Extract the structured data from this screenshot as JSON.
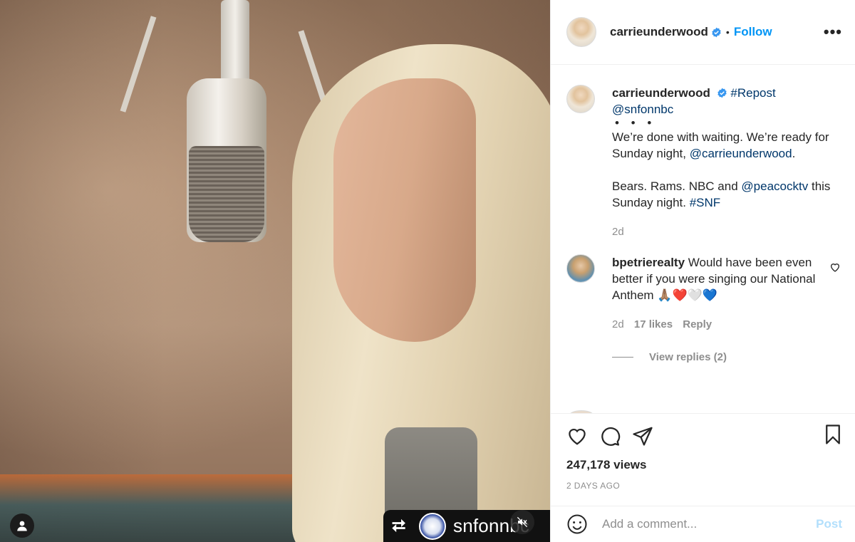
{
  "header": {
    "username": "carrieunderwood",
    "separator": "•",
    "follow_label": "Follow",
    "more_label": "•••"
  },
  "caption": {
    "username": "carrieunderwood",
    "repost_tag": "#Repost",
    "repost_handle": "@snfonnbc",
    "ellipsis": "• • •",
    "line1": "We’re done with waiting. We’re ready for Sunday night,",
    "mention": "@carrieunderwood",
    "period": ".",
    "line2_start": "Bears. Rams. NBC and",
    "mention2": "@peacocktv",
    "line2_end": "this Sunday night.",
    "hashtag": "#SNF",
    "time": "2d"
  },
  "comment": {
    "username": "bpetrierealty",
    "text": "Would have been even better if you were singing our National Anthem 🙏🏽❤️🤍💙",
    "time": "2d",
    "likes": "17 likes",
    "reply_label": "Reply",
    "view_replies": "View replies (2)"
  },
  "actions": {
    "views": "247,178 views",
    "date": "2 DAYS AGO"
  },
  "comment_box": {
    "placeholder": "Add a comment...",
    "post_label": "Post"
  },
  "media": {
    "repost_icon": "⮂",
    "repost_account": "snfonnbc"
  },
  "colors": {
    "accent": "#0095f6",
    "link": "#00376b",
    "muted": "#8e8e8e",
    "post_disabled": "#b2dffc"
  },
  "icons": [
    "user-tag-icon",
    "mute-icon",
    "repost-icon",
    "verified-icon",
    "heart-icon",
    "comment-icon",
    "share-icon",
    "bookmark-icon",
    "emoji-icon",
    "more-icon"
  ]
}
